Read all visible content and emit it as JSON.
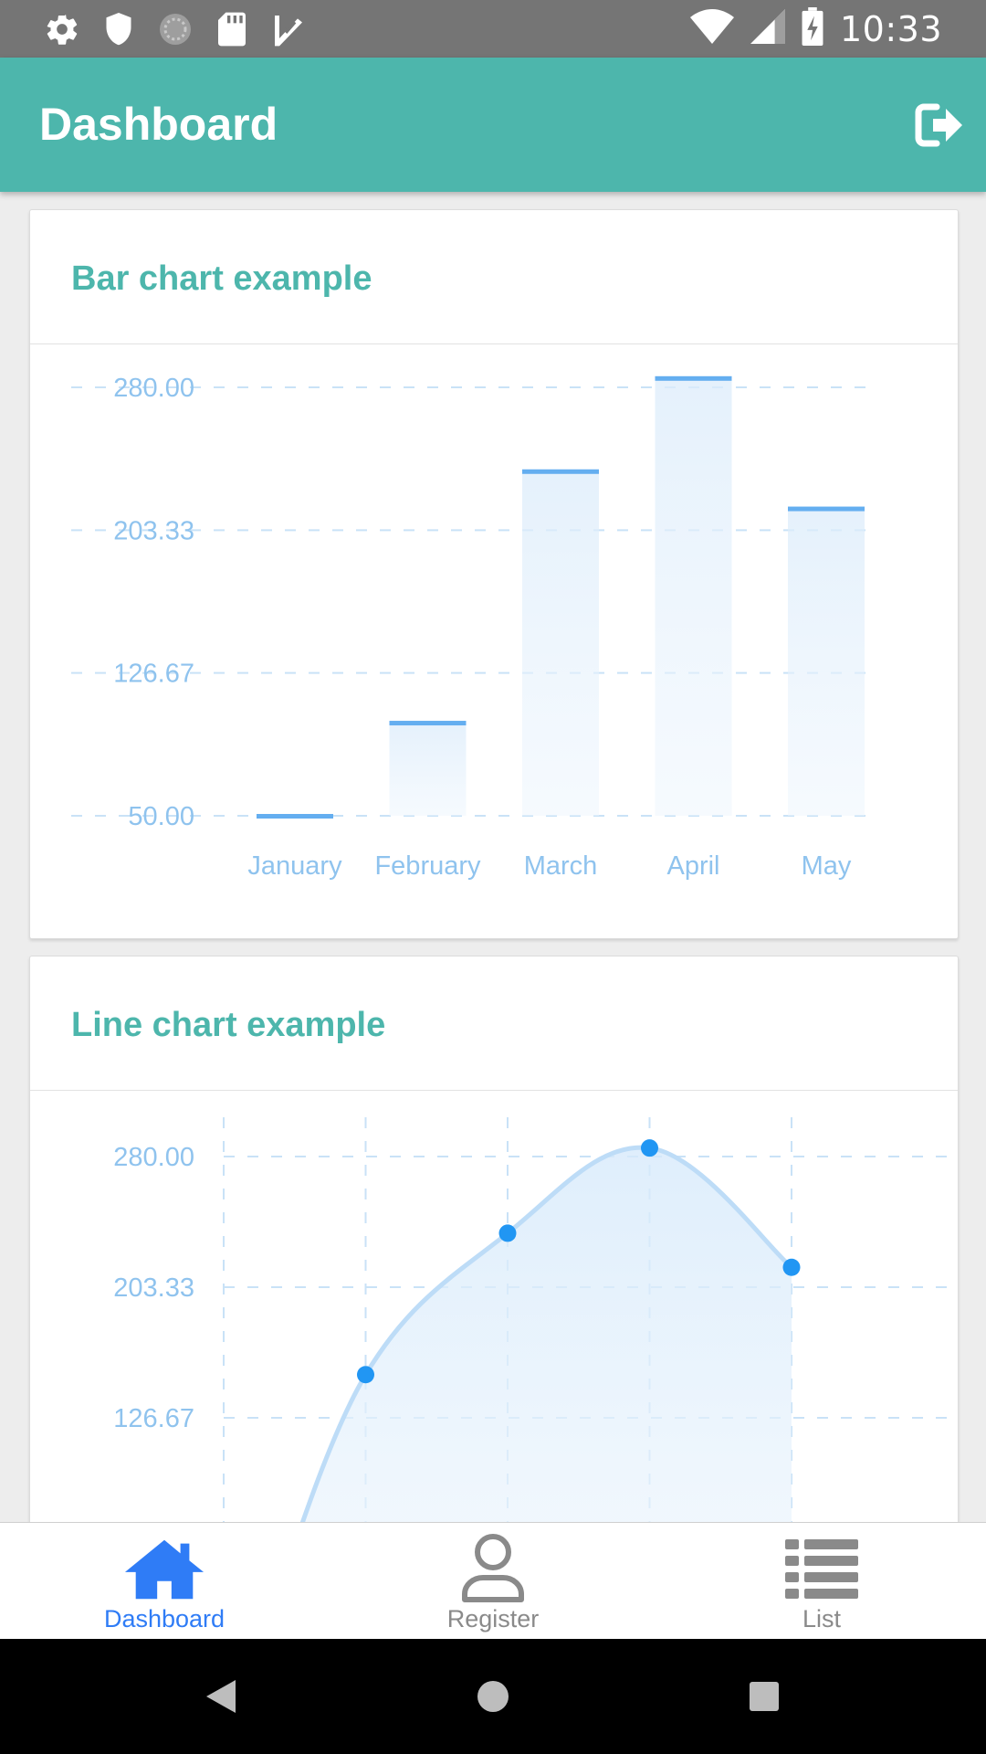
{
  "status_bar": {
    "time": "10:33",
    "left_icons": [
      "gear-icon",
      "shield-icon",
      "sync-icon",
      "sd-card-icon",
      "task-check-icon"
    ],
    "right_icons": [
      "wifi-icon",
      "signal-icon",
      "battery-charging-icon"
    ]
  },
  "app_bar": {
    "title": "Dashboard",
    "action_icon": "logout-icon"
  },
  "colors": {
    "app_bar": "#4db6ac",
    "card_title": "#4db6ac",
    "chart_line": "#2196f3",
    "chart_label": "#8fc3ee",
    "nav_active": "#2f7cf6",
    "nav_inactive": "#8a8a8a"
  },
  "cards": {
    "bar": {
      "title": "Bar chart example"
    },
    "line": {
      "title": "Line chart example"
    }
  },
  "chart_data": [
    {
      "type": "bar",
      "title": "Bar chart example",
      "categories": [
        "January",
        "February",
        "March",
        "April",
        "May"
      ],
      "values": [
        50,
        100,
        235,
        285,
        215
      ],
      "yticks": [
        "280.00",
        "203.33",
        "126.67",
        "50.00"
      ],
      "ylim": [
        50,
        280
      ],
      "grid": true
    },
    {
      "type": "line",
      "title": "Line chart example",
      "points_visible": [
        {
          "x": 1,
          "y": 152
        },
        {
          "x": 2,
          "y": 235
        },
        {
          "x": 3,
          "y": 285
        },
        {
          "x": 4,
          "y": 215
        }
      ],
      "yticks": [
        "280.00",
        "203.33",
        "126.67"
      ],
      "ylim": [
        50,
        280
      ],
      "grid": true
    }
  ],
  "bottom_nav": {
    "items": [
      {
        "label": "Dashboard",
        "icon": "home-icon",
        "active": true
      },
      {
        "label": "Register",
        "icon": "person-icon",
        "active": false
      },
      {
        "label": "List",
        "icon": "list-icon",
        "active": false
      }
    ]
  },
  "system_nav": {
    "icons": [
      "back-icon",
      "home-circle-icon",
      "recents-icon"
    ]
  }
}
